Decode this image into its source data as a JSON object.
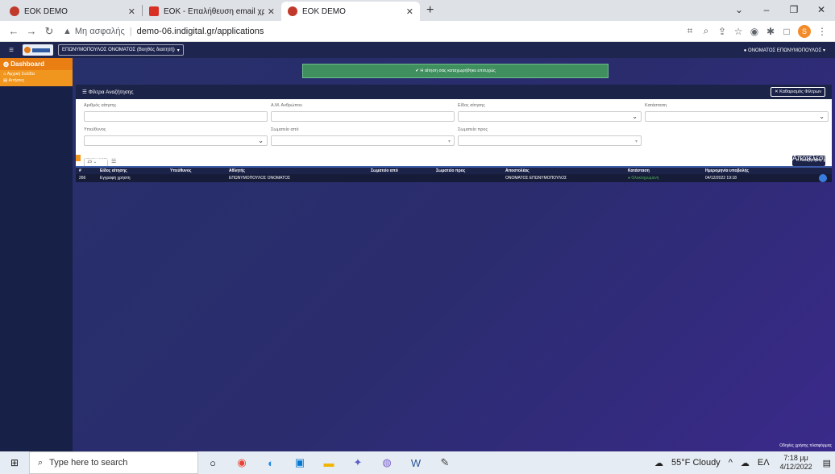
{
  "browser": {
    "tabs": [
      {
        "title": "EOK DEMO",
        "favicon_color": "#c0392b"
      },
      {
        "title": "EOK - Επαλήθευση email χρήστη",
        "favicon_color": "#d93025"
      },
      {
        "title": "EOK DEMO",
        "favicon_color": "#c0392b"
      }
    ],
    "window_controls": {
      "chevron": "⌄",
      "minimize": "–",
      "restore": "❐",
      "close": "✕"
    },
    "address": {
      "insecure_label": "Μη ασφαλής",
      "url": "demo-06.indigital.gr/applications"
    },
    "profile_initial": "S"
  },
  "app": {
    "role_select": "ΕΠΩΝΥΜΟΠΟΥΛΟΣ ΟΝΟΜΑΤΟΣ (Βοηθός διαιτητή)",
    "user_menu": "ΟΝΟΜΑΤΟΣ ΕΠΩΝΥΜΟΠΟΥΛΟΣ",
    "sidebar": {
      "header": "Dashboard",
      "items": [
        "Αρχική Σελίδα",
        "Αιτήσεις"
      ]
    },
    "alert": "Η αίτηση σας καταχωρήθηκε επιτυχώς",
    "filters": {
      "header": "Φίλτρα Αναζήτησης",
      "clear_label": "Καθαρισμός Φίλτρων",
      "fields": [
        {
          "label": "Αριθμός αίτησης"
        },
        {
          "label": "Α.Μ. Ανθρώπου"
        },
        {
          "label": "Είδος αίτησης"
        },
        {
          "label": "Κατάσταση"
        },
        {
          "label": "Υπεύθυνος"
        },
        {
          "label": "Σωματείο από"
        },
        {
          "label": "Σωματείο προς"
        }
      ],
      "page_size": "15",
      "search_label": "Αναζήτηση"
    },
    "results": {
      "title": "Ειδικά αιτήματα",
      "count_label": "1 Αποτέλεσμα",
      "columns": [
        "#",
        "Είδος αίτησης",
        "Υπεύθυνος",
        "Αθλητής",
        "Σωματείο από",
        "Σωματείο προς",
        "Αποστολέας",
        "Κατάσταση",
        "Ημερομηνία υποβολής"
      ],
      "rows": [
        {
          "id": "266",
          "type": "Εγγραφή χρήστη",
          "owner": "",
          "athlete": "ΕΠΩΝΥΜΟΠΟΥΛΟΣ ΟΝΟΜΑΤΟΣ",
          "from": "",
          "to": "",
          "sender": "ΟΝΟΜΑΤΟΣ ΕΠΩΝΥΜΟΠΟΥΛΟΣ",
          "status": "Ολοκληρωμένη",
          "date": "04/12/2022 19:18"
        }
      ]
    },
    "help_link": "Οδηγίες χρήσης πλατφόρμας"
  },
  "taskbar": {
    "search_placeholder": "Type here to search",
    "weather": "55°F Cloudy",
    "lang": "ΕΛ",
    "time": "7:18 μμ",
    "date": "4/12/2022"
  }
}
